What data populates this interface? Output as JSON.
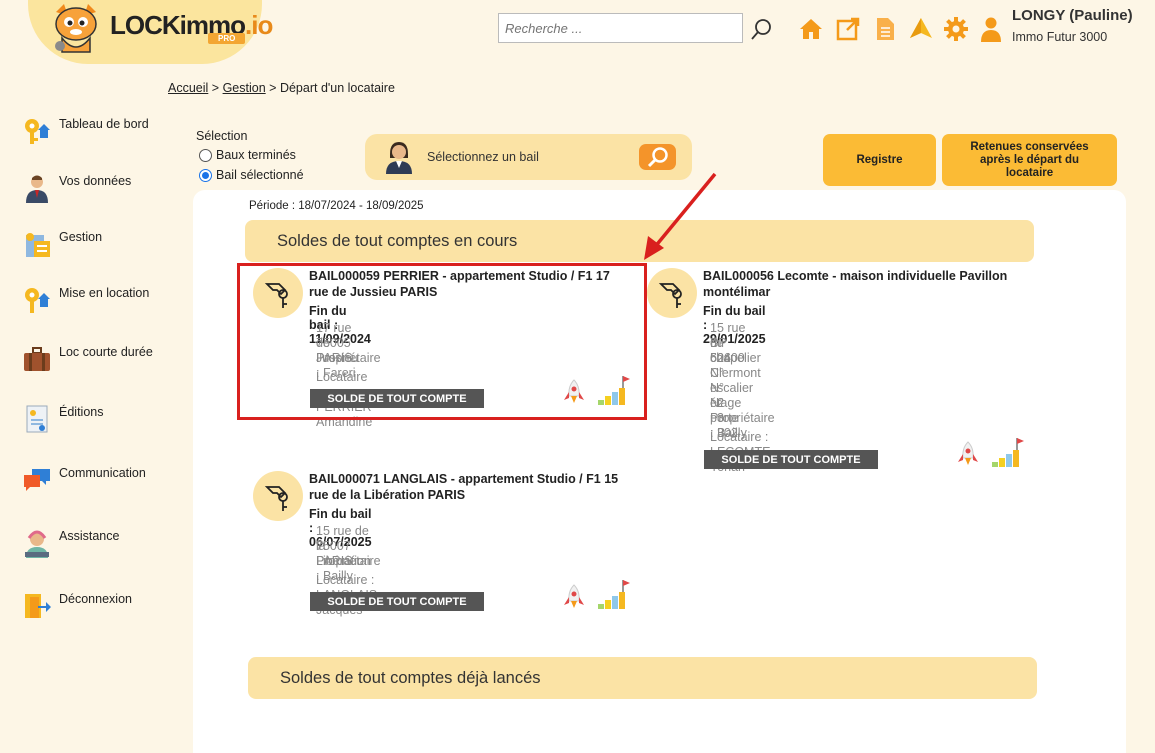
{
  "brand": {
    "name_main": "LOCKimmo",
    "name_suffix": ".io",
    "badge": "PRO"
  },
  "search": {
    "placeholder": "Recherche ..."
  },
  "user": {
    "name": "LONGY (Pauline)",
    "company": "Immo Futur 3000"
  },
  "breadcrumb": {
    "home": "Accueil",
    "section": "Gestion",
    "sep": ">",
    "current": "Départ d'un locataire"
  },
  "sidebar": {
    "items": [
      {
        "label": "Tableau de bord",
        "icon": "dashboard-keys-icon"
      },
      {
        "label": "Vos données",
        "icon": "person-icon"
      },
      {
        "label": "Gestion",
        "icon": "management-icon"
      },
      {
        "label": "Mise en location",
        "icon": "rental-keys-icon"
      },
      {
        "label": "Loc courte durée",
        "icon": "suitcase-icon"
      },
      {
        "label": "Éditions",
        "icon": "document-icon"
      },
      {
        "label": "Communication",
        "icon": "chat-icon"
      },
      {
        "label": "Assistance",
        "icon": "support-agent-icon"
      },
      {
        "label": "Déconnexion",
        "icon": "logout-icon"
      }
    ]
  },
  "selection": {
    "title": "Sélection",
    "options": [
      {
        "label": "Baux terminés",
        "selected": false
      },
      {
        "label": "Bail sélectionné",
        "selected": true
      }
    ],
    "bail_prompt": "Sélectionnez un bail"
  },
  "actions": {
    "registre": "Registre",
    "retenues": "Retenues conservées après le départ du locataire"
  },
  "periode": "Période : 18/07/2024 - 18/09/2025",
  "sections": {
    "en_cours": "Soldes de tout comptes en cours",
    "lances": "Soldes de tout comptes déjà lancés"
  },
  "solde_button": "SOLDE DE TOUT COMPTE",
  "cards": [
    {
      "title": "BAIL000059 PERRIER - appartement Studio / F1 17 rue de Jussieu PARIS",
      "fin": "Fin du bail : 11/09/2024",
      "address": [
        "17 rue de Jussieu",
        "75005 PARIS",
        "Propriétaire : Fareri"
      ],
      "locataire": "Locataire : PERRIER Amandine"
    },
    {
      "title": "BAIL000056 Lecomte - maison individuelle Pavillon montélimar",
      "fin": "Fin du bail : 29/01/2025",
      "address": [
        "15 rue du chapelier",
        "BP 524",
        "60600 Clermont",
        "N° escalier : 2",
        "N° étage : 3",
        "N° porte : 302",
        "Propriétaire : Bailly"
      ],
      "locataire": "Locataire : LECOMTE Yohan"
    },
    {
      "title": "BAIL000071 LANGLAIS - appartement Studio / F1 15 rue de la Libération PARIS",
      "fin": "Fin du bail : 06/07/2025",
      "address": [
        "15 rue de la Libération",
        "75007 PARIS",
        "Propriétaire : Bailly"
      ],
      "locataire": "Locataire : LANGLAIS Jacques"
    }
  ],
  "colors": {
    "accent": "#fbbb35",
    "highlight": "#d9201e",
    "section_bg": "#fbe3a5"
  }
}
